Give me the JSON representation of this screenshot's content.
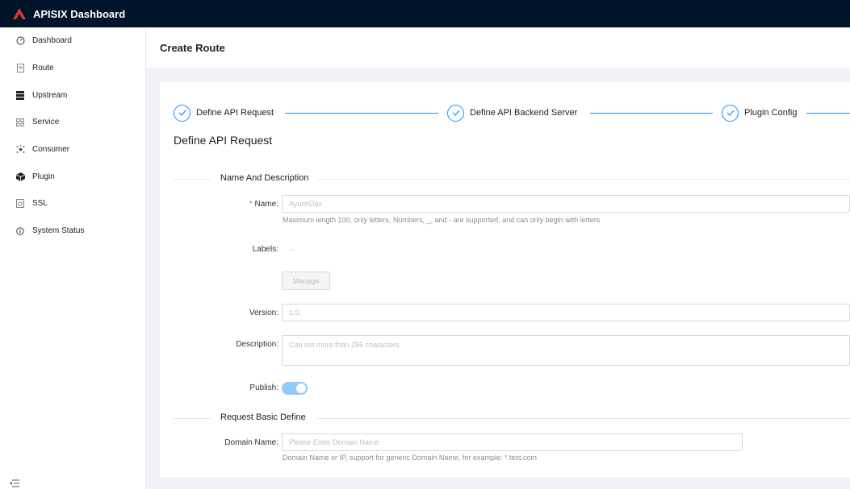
{
  "app": {
    "title": "APISIX Dashboard",
    "brand_color": "#e8322f"
  },
  "sidebar": {
    "items": [
      {
        "label": "Dashboard",
        "icon": "dashboard-icon"
      },
      {
        "label": "Route",
        "icon": "route-icon"
      },
      {
        "label": "Upstream",
        "icon": "upstream-icon"
      },
      {
        "label": "Service",
        "icon": "service-icon"
      },
      {
        "label": "Consumer",
        "icon": "consumer-icon"
      },
      {
        "label": "Plugin",
        "icon": "plugin-icon"
      },
      {
        "label": "SSL",
        "icon": "ssl-icon"
      },
      {
        "label": "System Status",
        "icon": "info-icon"
      }
    ]
  },
  "page": {
    "title": "Create Route"
  },
  "steps": [
    {
      "label": "Define API Request",
      "status": "done"
    },
    {
      "label": "Define API Backend Server",
      "status": "done"
    },
    {
      "label": "Plugin Config",
      "status": "done"
    }
  ],
  "form": {
    "section_title": "Define API Request",
    "group1_title": "Name And Description",
    "name": {
      "required_mark": "*",
      "label": "Name",
      "colon": ":",
      "value": "AyushDas",
      "help": "Maximum length 100, only letters, Numbers, _, and - are supported, and can only begin with letters"
    },
    "labels": {
      "label": "Labels",
      "colon": ":",
      "value": "--",
      "manage_button": "Manage"
    },
    "version": {
      "label": "Version",
      "colon": ":",
      "value": "1.0"
    },
    "description": {
      "label": "Description",
      "colon": ":",
      "placeholder": "Can not more than 256 characters"
    },
    "publish": {
      "label": "Publish",
      "colon": ":",
      "enabled": true
    },
    "group2_title": "Request Basic Define",
    "domain": {
      "label": "Domain Name",
      "colon": ":",
      "placeholder": "Please Enter Domain Name",
      "help": "Domain Name or IP, support for generic Domain Name, for example: *.test.com"
    }
  },
  "colors": {
    "accent": "#1890ff",
    "header_bg": "#001529",
    "switch_on": "#91caff"
  }
}
